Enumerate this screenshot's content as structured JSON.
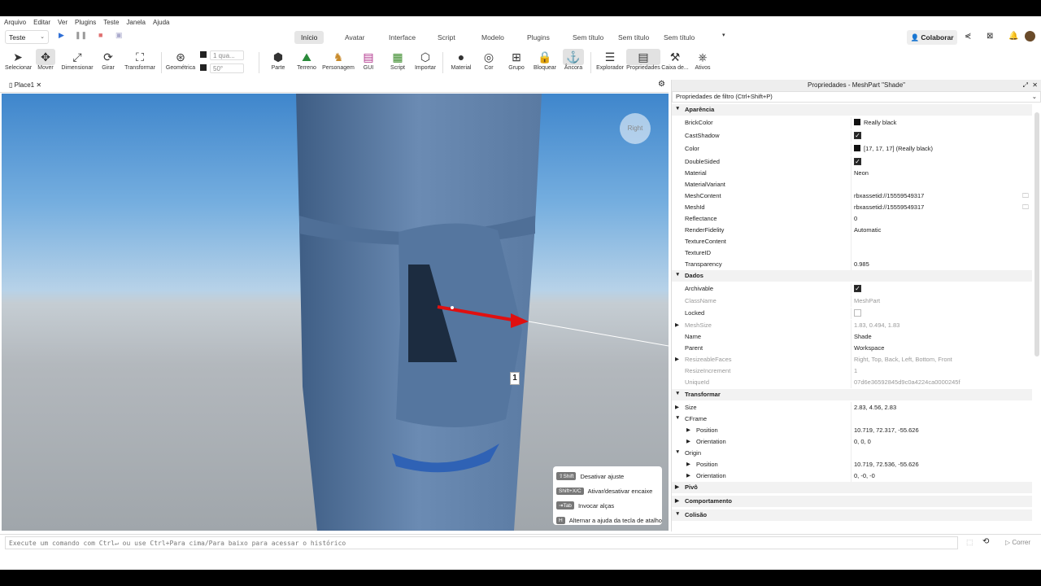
{
  "menubar": [
    "Arquivo",
    "Editar",
    "Ver",
    "Plugins",
    "Teste",
    "Janela",
    "Ajuda"
  ],
  "mode_select": "Teste",
  "ribbon_tabs": [
    "Início",
    "Avatar",
    "Interface",
    "Script",
    "Modelo",
    "Plugins",
    "Sem título",
    "Sem título",
    "Sem título"
  ],
  "collab_label": "Colaborar",
  "tools": {
    "selecionar": "Selecionar",
    "mover": "Mover",
    "dimensionar": "Dimensionar",
    "girar": "Girar",
    "transformar": "Transformar",
    "geometrica": "Geométrica",
    "parte": "Parte",
    "terreno": "Terreno",
    "personagem": "Personagem",
    "gui": "GUI",
    "script": "Script",
    "importar": "Importar",
    "material": "Material",
    "cor": "Cor",
    "grupo": "Grupo",
    "bloquear": "Bloquear",
    "ancora": "Âncora",
    "explorador": "Explorador",
    "propriedades": "Propriedades",
    "caixa": "Caixa de...",
    "ativos": "Ativos"
  },
  "snap": {
    "move": "1 qua...",
    "rotate": "50°"
  },
  "doc_tab": "Place1",
  "viewport": {
    "gizmo_label": "Right",
    "marker": "1",
    "hints": [
      {
        "key": "⇧Shift",
        "text": "Desativar ajuste"
      },
      {
        "key": "Shift+X/C",
        "text": "Ativar/desativar encaixe"
      },
      {
        "key": "⇥Tab",
        "text": "Invocar alças"
      },
      {
        "key": "H",
        "text": "Alternar a ajuda da tecla de atalho"
      }
    ]
  },
  "props": {
    "title": "Propriedades - MeshPart \"Shade\"",
    "filter": "Propriedades de filtro (Ctrl+Shift+P)",
    "rows": [
      {
        "cat": true,
        "open": true,
        "name": "Aparência"
      },
      {
        "name": "BrickColor",
        "value": "Really black",
        "swatch": true
      },
      {
        "name": "CastShadow",
        "check": "on"
      },
      {
        "name": "Color",
        "value": "[17, 17, 17] (Really black)",
        "swatch": true
      },
      {
        "name": "DoubleSided",
        "check": "on"
      },
      {
        "name": "Material",
        "value": "Neon"
      },
      {
        "name": "MaterialVariant",
        "value": ""
      },
      {
        "name": "MeshContent",
        "value": "rbxassetid://15559549317",
        "folder": true
      },
      {
        "name": "MeshId",
        "value": "rbxassetid://15559549317",
        "folder": true
      },
      {
        "name": "Reflectance",
        "value": "0"
      },
      {
        "name": "RenderFidelity",
        "value": "Automatic"
      },
      {
        "name": "TextureContent",
        "value": ""
      },
      {
        "name": "TextureID",
        "value": ""
      },
      {
        "name": "Transparency",
        "value": "0.985"
      },
      {
        "cat": true,
        "open": true,
        "name": "Dados"
      },
      {
        "name": "Archivable",
        "check": "on"
      },
      {
        "name": "ClassName",
        "value": "MeshPart",
        "dim": true
      },
      {
        "name": "Locked",
        "check": "off"
      },
      {
        "name": "MeshSize",
        "value": "1.83, 0.494, 1.83",
        "dim": true,
        "exp": true
      },
      {
        "name": "Name",
        "value": "Shade"
      },
      {
        "name": "Parent",
        "value": "Workspace"
      },
      {
        "name": "ResizeableFaces",
        "value": "Right, Top, Back, Left, Bottom, Front",
        "dim": true,
        "exp": true
      },
      {
        "name": "ResizeIncrement",
        "value": "1",
        "dim": true
      },
      {
        "name": "UniqueId",
        "value": "07d6e36592845d9c0a4224ca0000245f",
        "dim": true
      },
      {
        "cat": true,
        "open": true,
        "name": "Transformar"
      },
      {
        "name": "Size",
        "value": "2.83, 4.56, 2.83",
        "exp": true
      },
      {
        "name": "CFrame",
        "value": "",
        "open": true
      },
      {
        "name": "Position",
        "value": "10.719, 72.317, -55.626",
        "indent": true,
        "exp": true
      },
      {
        "name": "Orientation",
        "value": "0, 0, 0",
        "indent": true,
        "exp": true
      },
      {
        "name": "Origin",
        "value": "",
        "open": true
      },
      {
        "name": "Position",
        "value": "10.719, 72.536, -55.626",
        "indent": true,
        "exp": true
      },
      {
        "name": "Orientation",
        "value": "0, -0, -0",
        "indent": true,
        "exp": true
      },
      {
        "cat": true,
        "open": false,
        "name": "Pivô"
      },
      {
        "cat": true,
        "open": false,
        "name": "Comportamento"
      },
      {
        "cat": true,
        "open": true,
        "name": "Colisão"
      }
    ]
  },
  "cmd_placeholder": "Execute um comando com Ctrl↵ ou use Ctrl+Para cima/Para baixo para acessar o histórico",
  "run_label": "Correr",
  "colors": {
    "accent": "#2f6fd6",
    "gizmo_arrow": "#e01010",
    "mesh": "#5b7ea6",
    "stripe": "#2f62b5"
  }
}
